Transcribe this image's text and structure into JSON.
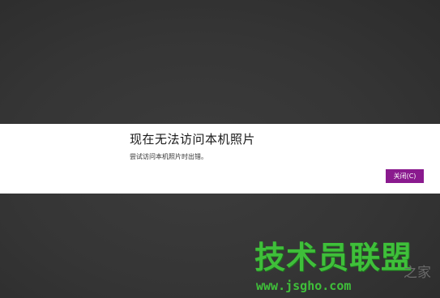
{
  "dialog": {
    "title": "现在无法访问本机照片",
    "message": "尝试访问本机照片时出错。",
    "close_label": "关闭(C)"
  },
  "watermark": {
    "brand": "技术员联盟",
    "suffix": "之家",
    "url": "www.jsgho.com"
  },
  "colors": {
    "background": "#353535",
    "dialog": "#ffffff",
    "accent": "#8a1a8e",
    "watermark": "#3fbf3a"
  }
}
